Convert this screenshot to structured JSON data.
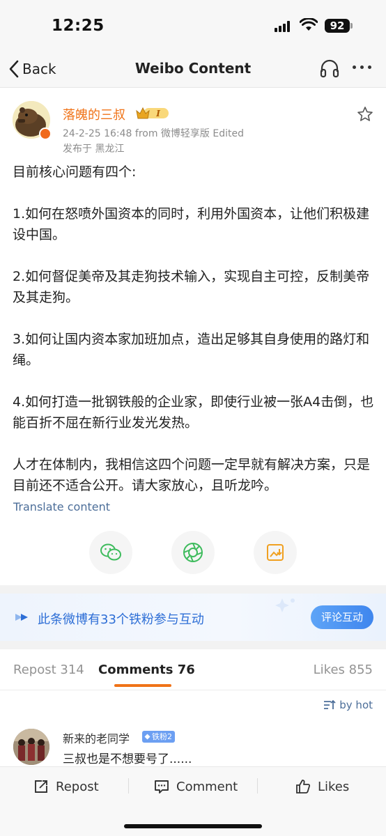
{
  "status_bar": {
    "time": "12:25",
    "battery": "92"
  },
  "nav": {
    "back_label": "Back",
    "title": "Weibo Content"
  },
  "post": {
    "author": "落魄的三叔",
    "level_badge": "I",
    "meta": "24-2-25 16:48  from 微博轻享版  Edited",
    "location": "发布于 黑龙江",
    "paragraphs": [
      "目前核心问题有四个:",
      "1.如何在怒喷外国资本的同时，利用外国资本，让他们积极建设中国。",
      "2.如何督促美帝及其走狗技术输入，实现自主可控，反制美帝及其走狗。",
      "3.如何让国内资本家加班加点，造出足够其自身使用的路灯和绳。",
      "4.如何打造一批钢铁般的企业家，即使行业被一张A4击倒，也能百折不屈在新行业发光发热。",
      "人才在体制内，我相信这四个问题一定早就有解决方案，只是目前还不适合公开。请大家放心，且听龙吟。"
    ],
    "translate_label": "Translate content"
  },
  "share": {
    "icons": [
      "wechat-icon",
      "moments-icon",
      "save-image-icon"
    ]
  },
  "fans_banner": {
    "text": "此条微博有33个铁粉参与互动",
    "button": "评论互动"
  },
  "tabs": {
    "repost": "Repost 314",
    "comments": "Comments 76",
    "likes": "Likes 855"
  },
  "sort_label": "by hot",
  "comment": {
    "name": "新来的老同学",
    "badge": "铁粉2",
    "text": "三叔也是不想要号了......"
  },
  "bottom_bar": {
    "repost": "Repost",
    "comment": "Comment",
    "likes": "Likes"
  },
  "colors": {
    "accent": "#f07318",
    "link": "#4c6e99",
    "fans_blue": "#2d6ed6"
  }
}
